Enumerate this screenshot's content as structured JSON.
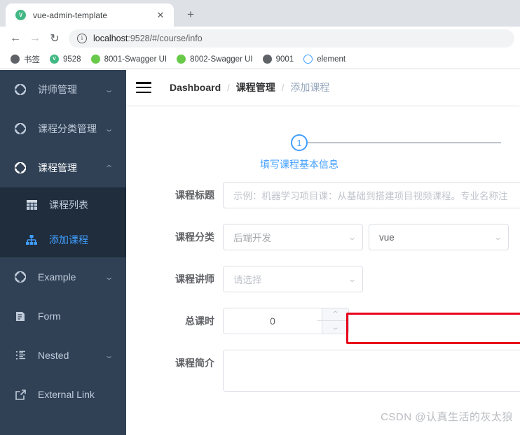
{
  "browser": {
    "tab": {
      "title": "vue-admin-template",
      "favicon": "vue-logo-icon",
      "close_label": "✕"
    },
    "new_tab_label": "+",
    "nav": {
      "back": "←",
      "forward": "→",
      "reload": "↻"
    },
    "omnibox": {
      "info_glyph": "i",
      "host": "localhost",
      "path": ":9528/#/course/info"
    },
    "bookmarks": [
      {
        "label": "书签",
        "icon": "globe-icon",
        "kind": "globe",
        "glyph": ""
      },
      {
        "label": "9528",
        "icon": "vue-icon",
        "kind": "vue",
        "glyph": "V"
      },
      {
        "label": "8001-Swagger UI",
        "icon": "swagger-icon",
        "kind": "swag",
        "glyph": ""
      },
      {
        "label": "8002-Swagger UI",
        "icon": "swagger-icon",
        "kind": "swag",
        "glyph": ""
      },
      {
        "label": "9001",
        "icon": "globe-icon",
        "kind": "globe",
        "glyph": ""
      },
      {
        "label": "element",
        "icon": "element-icon",
        "kind": "elem",
        "glyph": ""
      }
    ]
  },
  "sidebar": {
    "items": [
      {
        "label": "讲师管理",
        "icon": "component-icon",
        "arrow": "⌄"
      },
      {
        "label": "课程分类管理",
        "icon": "component-icon",
        "arrow": "⌄"
      },
      {
        "label": "课程管理",
        "icon": "component-icon",
        "arrow": "⌃"
      }
    ],
    "submenu": [
      {
        "label": "课程列表",
        "icon": "table-icon",
        "active": false
      },
      {
        "label": "添加课程",
        "icon": "tree-icon",
        "active": true
      }
    ],
    "items_bottom": [
      {
        "label": "Example",
        "icon": "component-icon",
        "arrow": "⌄"
      },
      {
        "label": "Form",
        "icon": "form-icon",
        "arrow": ""
      },
      {
        "label": "Nested",
        "icon": "nested-icon",
        "arrow": "⌄"
      },
      {
        "label": "External Link",
        "icon": "external-link-icon",
        "arrow": ""
      }
    ]
  },
  "navbar": {
    "hamburger": "hamburger-icon",
    "breadcrumb": [
      {
        "label": "Dashboard",
        "style": "first"
      },
      {
        "label": "课程管理",
        "style": "mid"
      },
      {
        "label": "添加课程",
        "style": "current"
      }
    ],
    "separator": "/"
  },
  "steps": {
    "current": "1",
    "title": "填写课程基本信息"
  },
  "form": {
    "title_row": {
      "label": "课程标题",
      "placeholder": "示例：机器学习项目课：从基础到搭建项目视频课程。专业名称注",
      "value": ""
    },
    "category_row": {
      "label": "课程分类",
      "parent_value": "后端开发",
      "child_value": "vue",
      "caret": "⌄"
    },
    "teacher_row": {
      "label": "课程讲师",
      "placeholder": "请选择",
      "caret": "⌄"
    },
    "lesson_row": {
      "label": "总课时",
      "value": "0",
      "up": "⌃",
      "down": "⌄"
    },
    "desc_row": {
      "label": "课程简介",
      "value": ""
    }
  },
  "watermark": "CSDN @认真生活的灰太狼",
  "colors": {
    "sidebar_bg": "#304156",
    "submenu_bg": "#1f2d3d",
    "accent": "#409eff",
    "annotation_red": "#e8001b",
    "vue_green": "#41b883"
  }
}
